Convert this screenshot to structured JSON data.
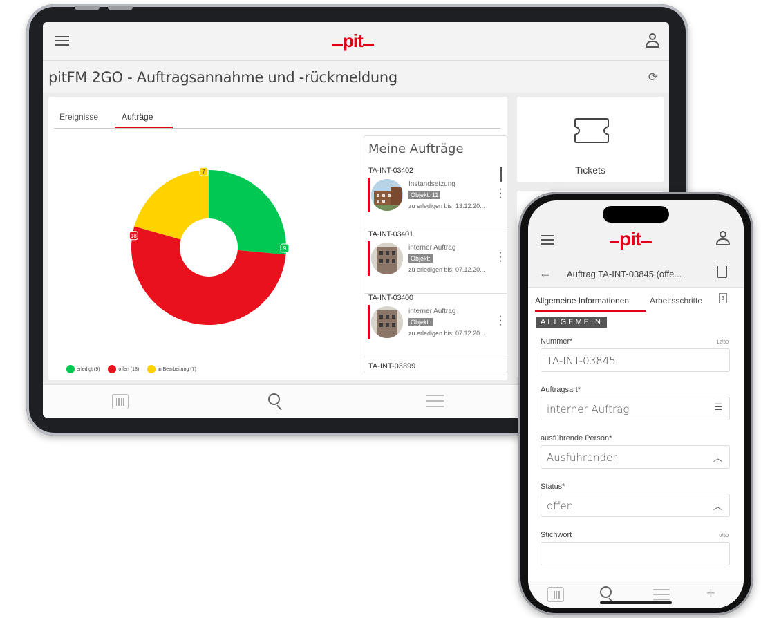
{
  "tablet": {
    "app_title": "pitFM 2GO - Auftragsannahme und -rückmeldung",
    "logo_text": "pit",
    "tabs": [
      {
        "label": "Ereignisse"
      },
      {
        "label": "Aufträge"
      }
    ],
    "chart_data": {
      "type": "pie",
      "categories": [
        "erledigt",
        "offen",
        "in Bearbeitung"
      ],
      "values": [
        9,
        18,
        7
      ],
      "colors": [
        "#00c853",
        "#e8111d",
        "#ffd200"
      ],
      "legend": [
        "erledigt (9)",
        "offen (18)",
        "in Bearbeitung (7)"
      ],
      "legend_position": "bottom-left"
    },
    "orders": {
      "title": "Meine Aufträge",
      "items": [
        {
          "number": "TA-INT-03402",
          "type": "Instandsetzung",
          "object": "Objekt: 11",
          "due": "zu erledigen bis: 13.12.20..."
        },
        {
          "number": "TA-INT-03401",
          "type": "interner Auftrag",
          "object": "Objekt:",
          "due": "zu erledigen bis: 07.12.20..."
        },
        {
          "number": "TA-INT-03400",
          "type": "interner Auftrag",
          "object": "Objekt:",
          "due": "zu erledigen bis: 07.12.20..."
        }
      ],
      "last_number": "TA-INT-03399"
    },
    "tickets_label": "Tickets"
  },
  "phone": {
    "logo_text": "pit",
    "title": "Auftrag TA-INT-03845 (offe...",
    "tabs": [
      {
        "label": "Allgemeine Informationen"
      },
      {
        "label": "Arbeitsschritte"
      }
    ],
    "tab_badge": "3",
    "section": "ALLGEMEIN",
    "fields": [
      {
        "label": "Nummer*",
        "value": "TA-INT-03845",
        "counter": "12/50"
      },
      {
        "label": "Auftragsart*",
        "value": "interner Auftrag",
        "suffix": "☰"
      },
      {
        "label": "ausführende Person*",
        "value": "Ausführender",
        "suffix": "︿"
      },
      {
        "label": "Status*",
        "value": "offen",
        "suffix": "︿"
      },
      {
        "label": "Stichwort",
        "value": "",
        "counter": "0/50"
      }
    ]
  },
  "colors": {
    "brand": "#e3001b"
  }
}
